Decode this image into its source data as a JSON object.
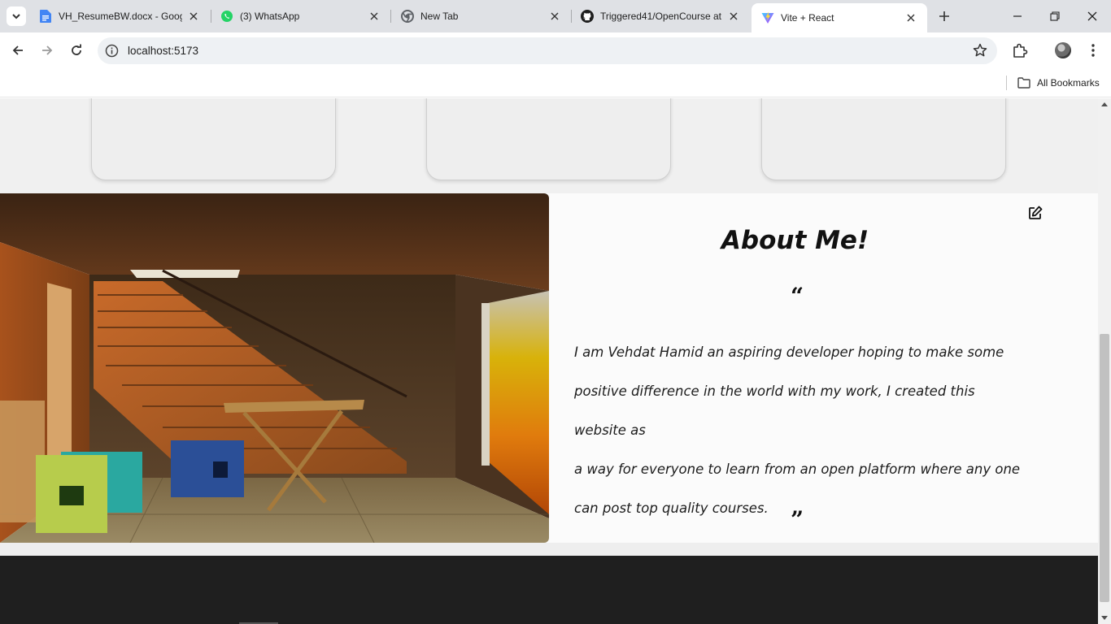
{
  "browser": {
    "tabs": [
      {
        "title": "VH_ResumeBW.docx - Goog",
        "icon": "google-docs-icon",
        "active": false
      },
      {
        "title": "(3) WhatsApp",
        "icon": "whatsapp-icon",
        "active": false
      },
      {
        "title": "New Tab",
        "icon": "chrome-icon",
        "active": false
      },
      {
        "title": "Triggered41/OpenCourse at",
        "icon": "github-icon",
        "active": false
      },
      {
        "title": "Vite + React",
        "icon": "vite-icon",
        "active": true
      }
    ],
    "address": "localhost:5173",
    "bookmarks_label": "All Bookmarks",
    "colors": {
      "tabstrip": "#dfe1e5",
      "omnibox": "#eef1f4"
    }
  },
  "page": {
    "about": {
      "title": "About Me!",
      "quote_open": "“",
      "quote_close": "”",
      "lines": [
        "I am Vehdat Hamid an aspiring developer hoping to make some",
        "positive difference in the world with my work, I created this website as",
        "a way for everyone to learn from an open platform where any one",
        "can post top quality courses."
      ],
      "image": "3d-rendered-room-with-staircase-table-and-cubes"
    },
    "colors": {
      "footer": "#1f1f1f",
      "card": "#eeeeee",
      "section": "#fbfbfb"
    }
  }
}
